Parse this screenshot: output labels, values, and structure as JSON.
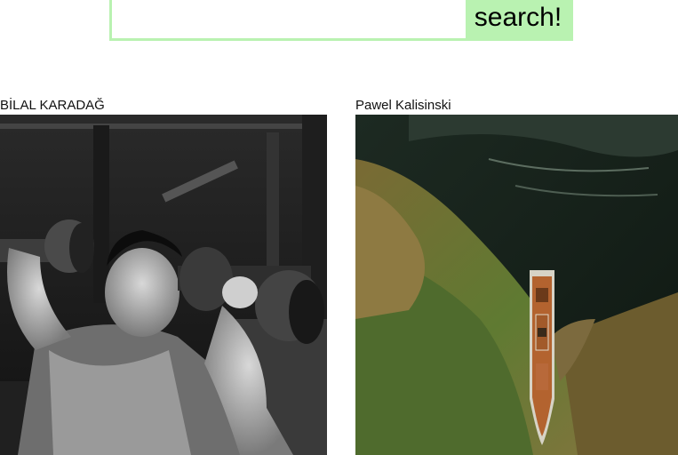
{
  "search": {
    "input_value": "",
    "input_placeholder": "",
    "button_label": "search!"
  },
  "results": [
    {
      "photographer": "BİLAL KARADAĞ",
      "image_subject": "man lifting dumbbells in gym",
      "image_tone": "black and white"
    },
    {
      "photographer": "Pawel Kalisinski",
      "image_subject": "aerial view of abandoned ship near shore",
      "image_tone": "color"
    }
  ],
  "colors": {
    "accent": "#b9f2b1",
    "background": "#ffffff",
    "text": "#111111"
  }
}
